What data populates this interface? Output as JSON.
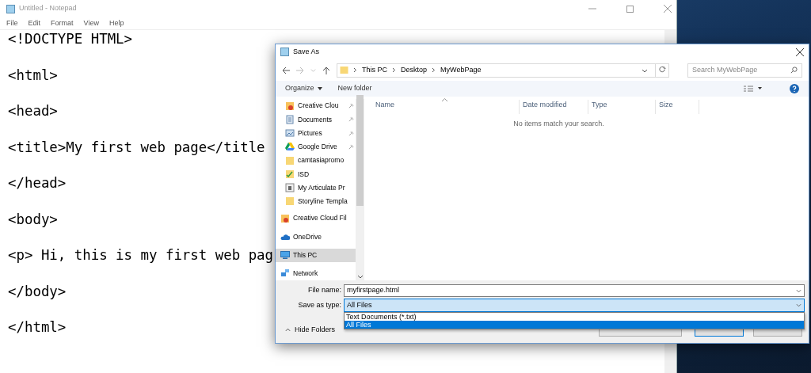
{
  "notepad": {
    "title": "Untitled - Notepad",
    "menu": [
      "File",
      "Edit",
      "Format",
      "View",
      "Help"
    ],
    "lines": [
      "<!DOCTYPE HTML>",
      "<html>",
      "<head>",
      "<title>My first web page</title",
      "</head>",
      "<body>",
      "<p> Hi, this is my first web pag",
      "</body>",
      "</html>"
    ]
  },
  "dialog": {
    "title": "Save As",
    "path": [
      "This PC",
      "Desktop",
      "MyWebPage"
    ],
    "search": {
      "placeholder": "Search MyWebPage"
    },
    "toolbar": {
      "organize": "Organize",
      "new_folder": "New folder"
    },
    "quick_access": [
      {
        "label": "Creative Clou",
        "kind": "creative",
        "pinned": true,
        "selected": false
      },
      {
        "label": "Documents",
        "kind": "documents",
        "pinned": true,
        "selected": false
      },
      {
        "label": "Pictures",
        "kind": "pictures",
        "pinned": true,
        "selected": false
      },
      {
        "label": "Google Drive",
        "kind": "drive",
        "pinned": true,
        "selected": false
      },
      {
        "label": "camtasiapromo",
        "kind": "folder",
        "pinned": false,
        "selected": false
      },
      {
        "label": "ISD",
        "kind": "check",
        "pinned": false,
        "selected": false
      },
      {
        "label": "My Articulate Pr",
        "kind": "articulate",
        "pinned": false,
        "selected": false
      },
      {
        "label": "Storyline Templa",
        "kind": "folder",
        "pinned": false,
        "selected": false
      }
    ],
    "locations": [
      {
        "label": "Creative Cloud Fil",
        "kind": "creative",
        "selected": false
      },
      {
        "label": "OneDrive",
        "kind": "cloud",
        "selected": false
      },
      {
        "label": "This PC",
        "kind": "pc",
        "selected": true
      },
      {
        "label": "Network",
        "kind": "network",
        "selected": false
      }
    ],
    "columns": [
      "Name",
      "Date modified",
      "Type",
      "Size"
    ],
    "empty_message": "No items match your search.",
    "file_name": {
      "label": "File name:",
      "value": "myfirstpage.html"
    },
    "save_type": {
      "label": "Save as type:",
      "value": "All Files",
      "options": [
        {
          "label": "Text Documents (*.txt)",
          "selected": false
        },
        {
          "label": "All Files",
          "selected": true
        }
      ]
    },
    "hide_folders": "Hide Folders"
  }
}
